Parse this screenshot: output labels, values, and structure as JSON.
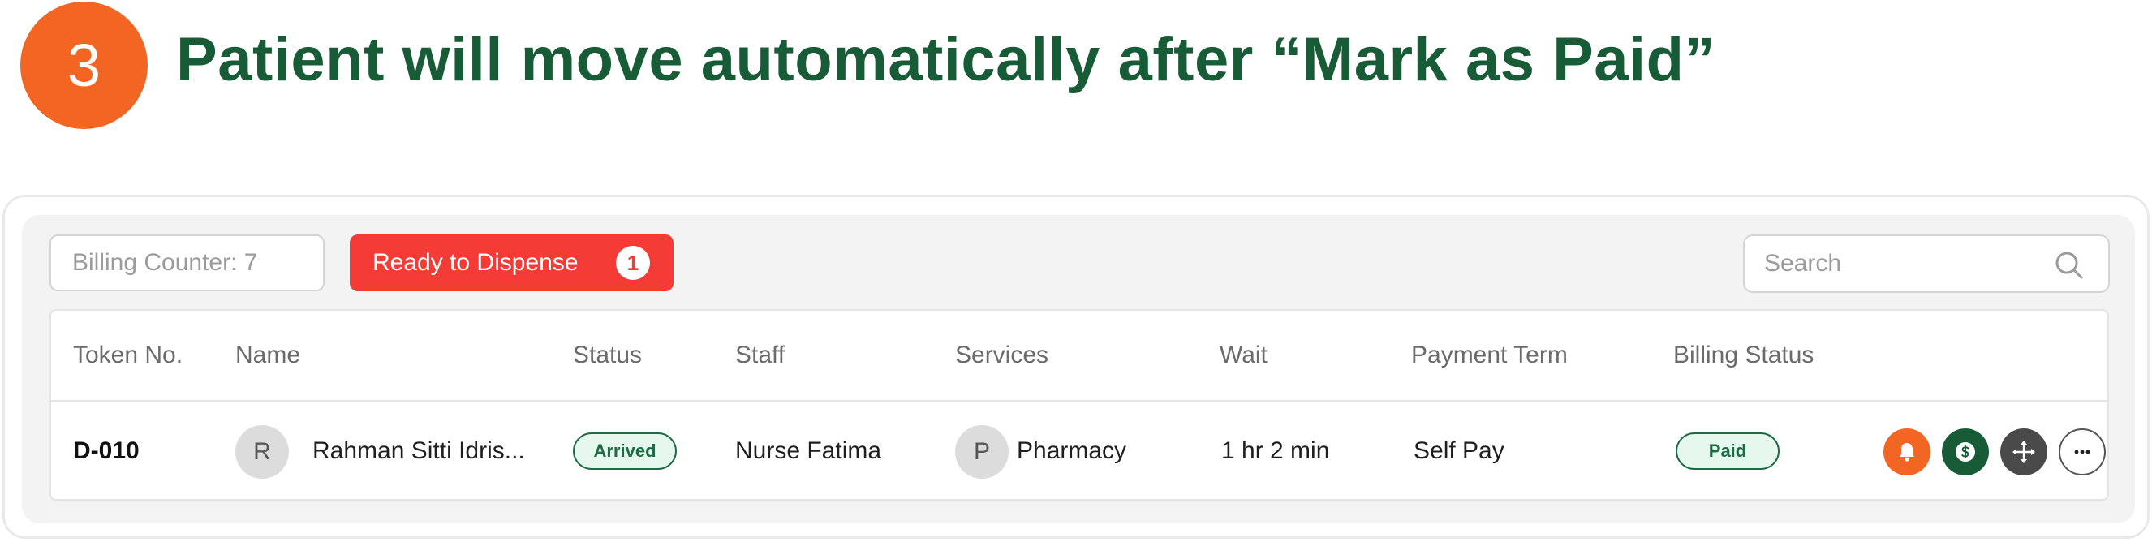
{
  "step": {
    "number": "3",
    "title": "Patient will move automatically after “Mark as Paid”"
  },
  "toolbar": {
    "billing_counter": "Billing Counter: 7",
    "ready_label": "Ready to Dispense",
    "ready_count": "1",
    "search_placeholder": "Search"
  },
  "table": {
    "headers": [
      "Token No.",
      "Name",
      "Status",
      "Staff",
      "Services",
      "Wait",
      "Payment Term",
      "Billing Status"
    ],
    "rows": [
      {
        "token": "D-010",
        "avatar_initial": "R",
        "name": "Rahman Sitti Idris...",
        "status": "Arrived",
        "staff": "Nurse Fatima",
        "service_initial": "P",
        "service": "Pharmacy",
        "wait": "1 hr 2 min",
        "payment_term": "Self Pay",
        "billing_status": "Paid"
      }
    ]
  },
  "actions": [
    {
      "icon": "bell-icon",
      "color": "#f26522"
    },
    {
      "icon": "dollar-icon",
      "color": "#185c37"
    },
    {
      "icon": "move-icon",
      "color": "#4a4a4a"
    },
    {
      "icon": "more-icon",
      "color": "#ffffff"
    }
  ],
  "colors": {
    "brand_green": "#185c37",
    "accent_orange": "#f26522",
    "alert_red": "#f53b35",
    "paid_bg": "#e6f7ee"
  }
}
